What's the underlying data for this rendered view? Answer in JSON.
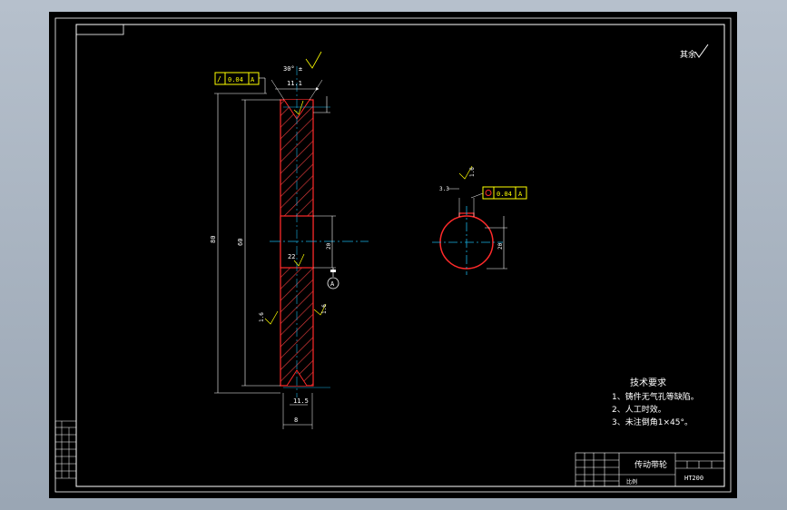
{
  "colors": {
    "frame": "#ffffff",
    "part_outline": "#ff2a2a",
    "centerline": "#19b3e6",
    "tolerance_frame": "#ffff00",
    "dimension": "#ffffff",
    "hatch": "#ff2a2a",
    "leader": "#00e000"
  },
  "surface_finish": {
    "rest_label": "其余"
  },
  "front_view": {
    "tolerance_value": "0.04",
    "tolerance_datum": "A",
    "angle_label": "30° ±",
    "width_label": "11.1",
    "overall_height_label": "80",
    "inner_height_label": "60",
    "bore_label": "22",
    "roughness_left": "1.6",
    "roughness_right": "1.6",
    "bottom_label": "11.5",
    "thickness_label": "8",
    "datum_label": "A",
    "bore_dim_label": "20"
  },
  "side_view": {
    "roughness_label": "1.6",
    "small_dim": "3.3",
    "tolerance_value": "0.04",
    "tolerance_datum": "A",
    "dia_label": "20"
  },
  "tech_requirements": {
    "title": "技术要求",
    "items": [
      "1、铸件无气孔等缺陷。",
      "2、人工时效。",
      "3、未注倒角1×45°。"
    ]
  },
  "title_block": {
    "part_name": "传动带轮",
    "scale_label": "比例",
    "material": "HT200"
  }
}
